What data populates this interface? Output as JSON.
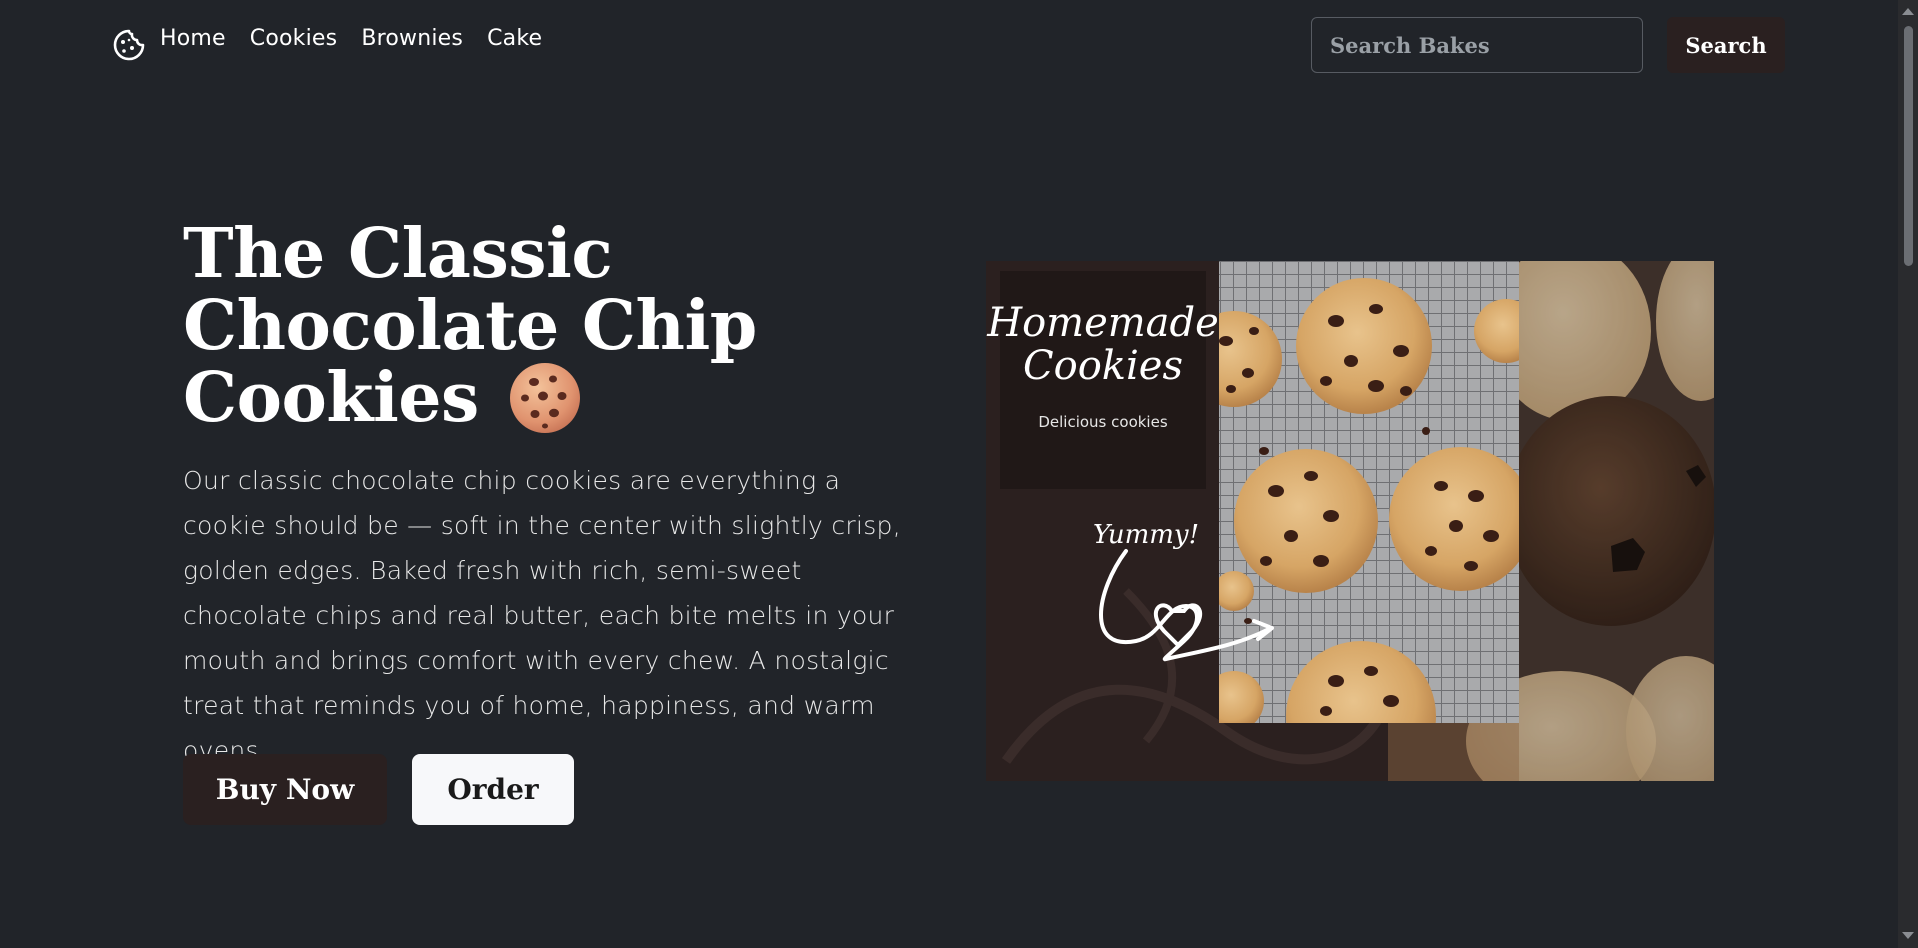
{
  "nav": {
    "brand_icon": "cookie-icon",
    "links": [
      "Home",
      "Cookies",
      "Brownies",
      "Cake"
    ],
    "search_placeholder": "Search Bakes",
    "search_button": "Search"
  },
  "hero": {
    "title_lines": [
      "The Classic",
      "Chocolate Chip",
      "Cookies"
    ],
    "title_emoji": "cookie-emoji",
    "description": "Our classic chocolate chip cookies are everything a cookie should be — soft in the center with slightly crisp, golden edges. Baked fresh with rich, semi-sweet chocolate chips and real butter, each bite melts in your mouth and brings comfort with every chew. A nostalgic treat that reminds you of home, happiness, and warm ovens.",
    "buy_button": "Buy Now",
    "order_button": "Order"
  },
  "banner": {
    "script_title_line1": "Homemade",
    "script_title_line2": "Cookies",
    "subtitle": "Delicious cookies",
    "note": "Yummy!"
  },
  "colors": {
    "background": "#212429",
    "dark_button": "#2a2020",
    "light_button": "#f7f8fa"
  }
}
